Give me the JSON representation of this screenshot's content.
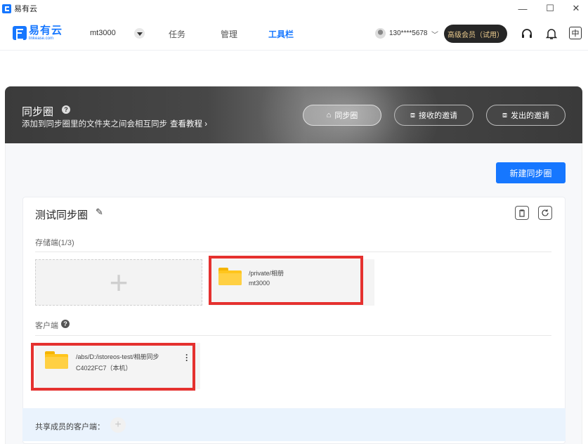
{
  "window": {
    "title": "易有云",
    "minimize": "—",
    "maximize": "☐",
    "close": "✕"
  },
  "nav": {
    "logo_name": "易有云",
    "logo_sub": "linkease.com",
    "device": "mt3000",
    "tabs": [
      "任务",
      "管理",
      "工具栏"
    ],
    "active_tab": "工具栏",
    "phone": "130****5678",
    "vip_label": "高级会员（试用）",
    "lang": "中"
  },
  "banner": {
    "title": "同步圈",
    "help": "?",
    "desc": "添加到同步圈里的文件夹之间会相互同步",
    "link": "查看教程 ›",
    "buttons": [
      "同步圈",
      "接收的邀请",
      "发出的邀请"
    ]
  },
  "main": {
    "new_button": "新建同步圈",
    "card": {
      "title": "测试同步圈",
      "storage_label": "存储端(1/3)",
      "storage_items": [
        {
          "path": "/private/相册",
          "device": "mt3000"
        }
      ],
      "client_label": "客户端",
      "client_items": [
        {
          "path": "/abs/D:/istoreos-test/相册同步",
          "device": "C4022FC7（本机）"
        }
      ],
      "shared_label": "共享成员的客户端："
    }
  },
  "colors": {
    "accent": "#1677ff",
    "highlight_box": "#e5312f",
    "folder": "#ffc51c",
    "vip_text": "#e9c98c"
  }
}
